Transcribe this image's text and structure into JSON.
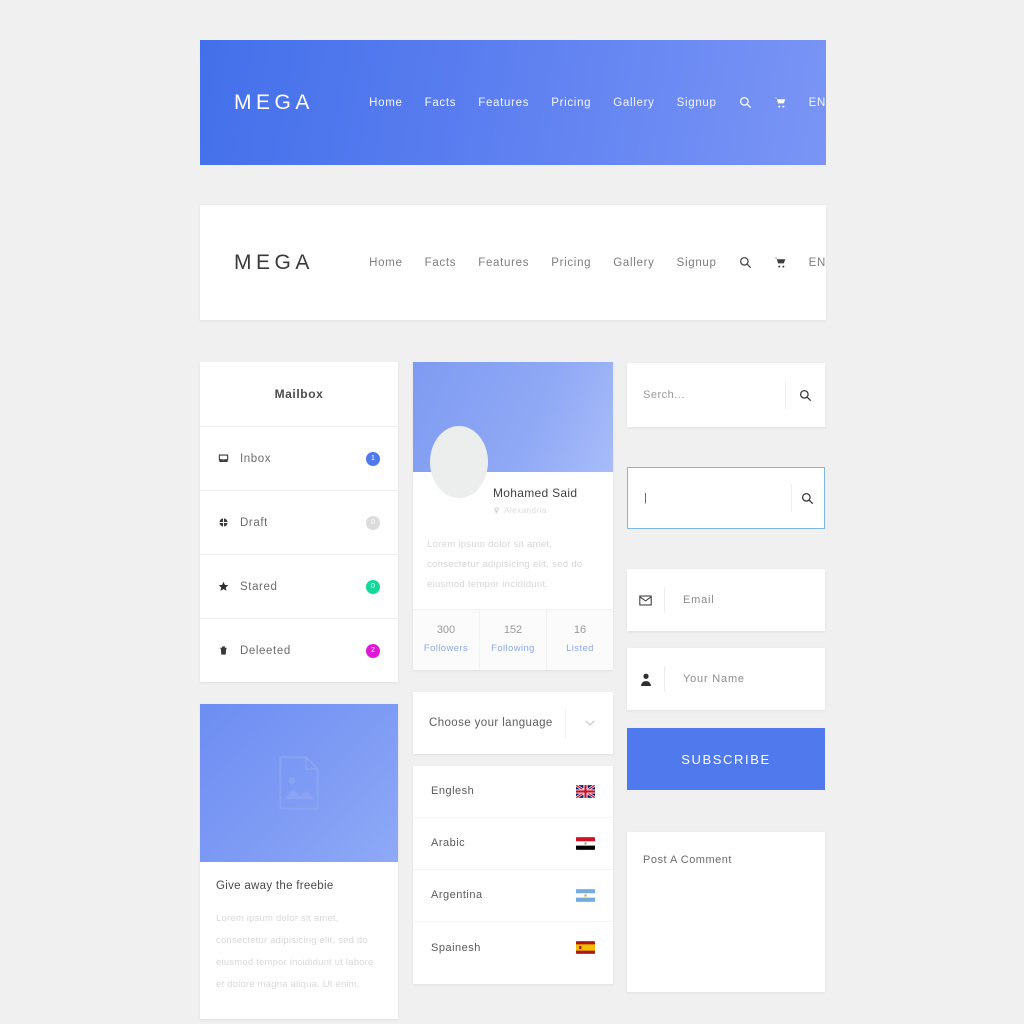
{
  "nav": {
    "brand": "MEGA",
    "links": [
      "Home",
      "Facts",
      "Features",
      "Pricing",
      "Gallery",
      "Signup"
    ],
    "lang_code": "EN",
    "search_icon": "search-icon",
    "cart_icon": "cart-icon"
  },
  "mailbox": {
    "title": "Mailbox",
    "items": [
      {
        "label": "Inbox",
        "icon": "inbox-icon",
        "badge": "1",
        "badge_color": "#4f79ec"
      },
      {
        "label": "Draft",
        "icon": "draft-icon",
        "badge": "0",
        "badge_color": "#dcdcdc"
      },
      {
        "label": "Stared",
        "icon": "star-icon",
        "badge": "0",
        "badge_color": "#14d89a"
      },
      {
        "label": "Deleeted",
        "icon": "trash-icon",
        "badge": "2",
        "badge_color": "#e016d8"
      }
    ]
  },
  "profile": {
    "name": "Mohamed Said",
    "location": "Alexandria",
    "bio": "Lorem ipsum dolor sit amet, consectetur adipisicing elit, sed do eiusmod tempor incididunt.",
    "stats": [
      {
        "value": "300",
        "label": "Followers"
      },
      {
        "value": "152",
        "label": "Following"
      },
      {
        "value": "16",
        "label": "Listed"
      }
    ]
  },
  "freebie": {
    "title": "Give away the freebie",
    "text": "Lorem ipsum dolor sit amet, consectetur adipisicing elit, sed do eiusmod tempor incididunt ut labore et dolore magna aliqua. Ut enim.",
    "image_icon": "image-placeholder-icon"
  },
  "language": {
    "select_label": "Choose your language",
    "chevron_icon": "chevron-down-icon",
    "options": [
      {
        "name": "Englesh",
        "flag": "uk-flag"
      },
      {
        "name": "Arabic",
        "flag": "egypt-flag"
      },
      {
        "name": "Argentina",
        "flag": "argentina-flag"
      },
      {
        "name": "Spainesh",
        "flag": "spain-flag"
      }
    ]
  },
  "search": {
    "placeholder": "Serch...",
    "value": "",
    "focused_value": "",
    "icon": "search-icon"
  },
  "subscribe": {
    "email_placeholder": "Email",
    "email_value": "",
    "email_icon": "envelope-icon",
    "name_placeholder": "Your Name",
    "name_value": "",
    "name_icon": "user-icon",
    "button_label": "SUBSCRIBE",
    "button_color": "#4f79ec"
  },
  "comment": {
    "placeholder": "Post A Comment",
    "value": ""
  },
  "colors": {
    "page_bg": "#f0f0f0",
    "accent": "#4f79ec",
    "cover": "#8ea9f6"
  }
}
